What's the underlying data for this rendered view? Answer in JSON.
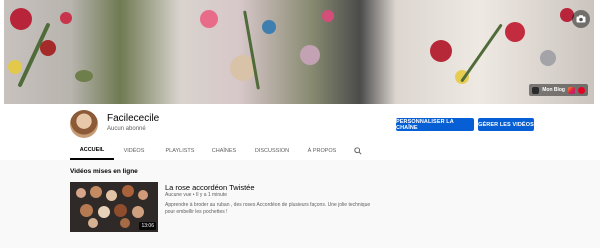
{
  "banner": {
    "links_label": "Mon Blog"
  },
  "channel": {
    "name": "Facilececile",
    "subscribers": "Aucun abonné"
  },
  "actions": {
    "customize_label": "PERSONNALISER LA CHAÎNE",
    "manage_label": "GÉRER LES VIDÉOS"
  },
  "tabs": [
    {
      "label": "ACCUEIL",
      "active": true
    },
    {
      "label": "VIDÉOS",
      "active": false
    },
    {
      "label": "PLAYLISTS",
      "active": false
    },
    {
      "label": "CHAÎNES",
      "active": false
    },
    {
      "label": "DISCUSSION",
      "active": false
    },
    {
      "label": "À PROPOS",
      "active": false
    }
  ],
  "section": {
    "title": "Vidéos mises en ligne"
  },
  "video": {
    "title": "La rose accordéon Twistée",
    "meta": "Aucune vue • Il y a 1 minute",
    "description": "Apprendre à broder au ruban , des roses Accordéon de plusieurs façons. Une jolie technique pour embellir les pochettes !",
    "duration": "13:06"
  },
  "colors": {
    "accent": "#065fd4",
    "text": "#030303",
    "secondary": "#606060"
  }
}
